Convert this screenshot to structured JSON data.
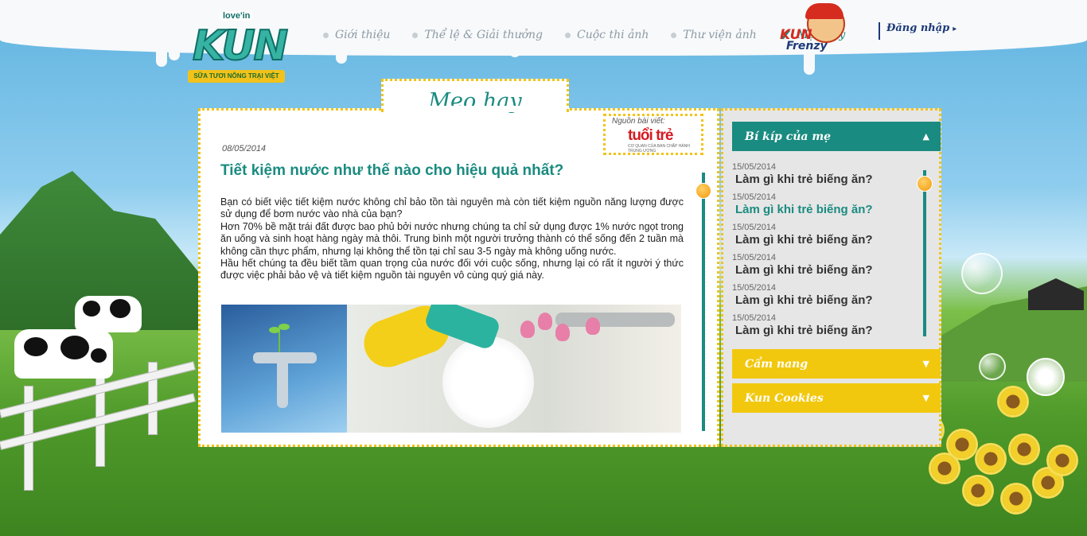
{
  "logo": {
    "top_text": "love'in",
    "main_text": "KUN",
    "ribbon_text": "SỮA TƯƠI NÔNG TRẠI VIỆT"
  },
  "nav": {
    "items": [
      {
        "label": "Giới thiệu",
        "active": false
      },
      {
        "label": "Thể lệ & Giải thưởng",
        "active": false
      },
      {
        "label": "Cuộc thi ảnh",
        "active": false
      },
      {
        "label": "Thư viện ảnh",
        "active": false
      },
      {
        "label": "Mẹo hay",
        "active": true
      }
    ],
    "partner_top": "KUN",
    "partner_bottom": "Frenzy",
    "login_label": "Đăng nhập",
    "login_arrow": "▸"
  },
  "main": {
    "tab_title": "Mẹo hay",
    "source_label": "Nguồn bài viết:",
    "source_brand": "tuổi trẻ",
    "source_sub": "CƠ QUAN CỦA BAN CHẤP HÀNH TRUNG ƯƠNG",
    "date": "08/05/2014",
    "title": "Tiết kiệm nước như thế nào cho hiệu quả nhất?",
    "paragraphs": [
      "Bạn có biết việc tiết kiệm nước không chỉ bảo tồn tài nguyên mà còn tiết kiệm nguồn năng lượng được sử dụng để bơm nước vào nhà của bạn?",
      "Hơn 70% bề mặt trái đất được bao phủ bởi nước nhưng chúng ta chỉ sử dụng được 1% nước ngọt trong ăn uống và sinh hoạt hàng ngày mà thôi. Trung bình một người trưởng thành có thể sống đến 2 tuần mà không cần thực phẩm, nhưng lại không thể tồn tại chỉ sau 3-5 ngày mà không uống nước.",
      "Hầu hết chúng ta đều biết tầm quan trọng của nước đối với cuộc sống, nhưng lại có rất ít người ý thức được việc phải bảo vệ và tiết kiệm nguồn tài nguyên vô cùng quý giá này."
    ]
  },
  "sidebar": {
    "section1": {
      "label": "Bí kíp của mẹ",
      "icon": "triangle-up-icon",
      "arrow": "▲"
    },
    "items": [
      {
        "date": "15/05/2014",
        "title": "Làm gì khi trẻ biếng ăn?",
        "active": false
      },
      {
        "date": "15/05/2014",
        "title": "Làm gì khi trẻ biếng ăn?",
        "active": true
      },
      {
        "date": "15/05/2014",
        "title": "Làm gì khi trẻ biếng ăn?",
        "active": false
      },
      {
        "date": "15/05/2014",
        "title": "Làm gì khi trẻ biếng ăn?",
        "active": false
      },
      {
        "date": "15/05/2014",
        "title": "Làm gì khi trẻ biếng ăn?",
        "active": false
      },
      {
        "date": "15/05/2014",
        "title": "Làm gì khi trẻ biếng ăn?",
        "active": false
      }
    ],
    "section2": {
      "label": "Cẩm nang",
      "icon": "triangle-down-icon",
      "arrow": "▼"
    },
    "section3": {
      "label": "Kun Cookies",
      "icon": "triangle-down-icon",
      "arrow": "▼"
    }
  },
  "colors": {
    "teal": "#1a8b80",
    "yellow": "#f2c80f",
    "dotted_border": "#f0c419"
  }
}
